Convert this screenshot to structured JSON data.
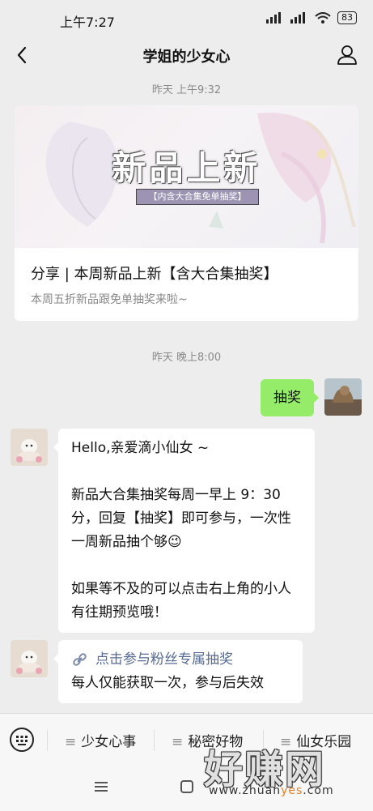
{
  "status": {
    "time": "上午7:27",
    "battery": "83"
  },
  "nav": {
    "title": "学姐的少女心"
  },
  "timestamps": [
    "昨天 上午9:32",
    "昨天 晚上8:00"
  ],
  "article": {
    "banner_title": "新品上新",
    "banner_subtitle": "【内含大合集免单抽奖】",
    "title": "分享 | 本周新品上新【含大合集抽奖】",
    "desc": "本周五折新品跟免单抽奖来啦~"
  },
  "messages": {
    "user_text": "抽奖",
    "reply_greeting": "Hello,亲爱滴小仙女 ~",
    "reply_p1": "新品大合集抽奖每周一早上 9：30分，回复【抽奖】即可参与，一次性一周新品抽个够",
    "reply_emoji": "😉",
    "reply_p2": "如果等不及的可以点击右上角的小人有往期预览哦！",
    "link_text": "点击参与粉丝专属抽奖",
    "link_note": "每人仅能获取一次，参与后失效"
  },
  "bottom_menu": [
    {
      "label": "少女心事"
    },
    {
      "label": "秘密好物"
    },
    {
      "label": "仙女乐园"
    }
  ],
  "watermark": {
    "title": "好赚网",
    "url_pre": "www.zhuan",
    "url_mid": "yes",
    "url_post": ".com"
  },
  "colors": {
    "chat_bg": "#ededed",
    "green_bubble": "#95ec69",
    "link": "#576b95"
  }
}
